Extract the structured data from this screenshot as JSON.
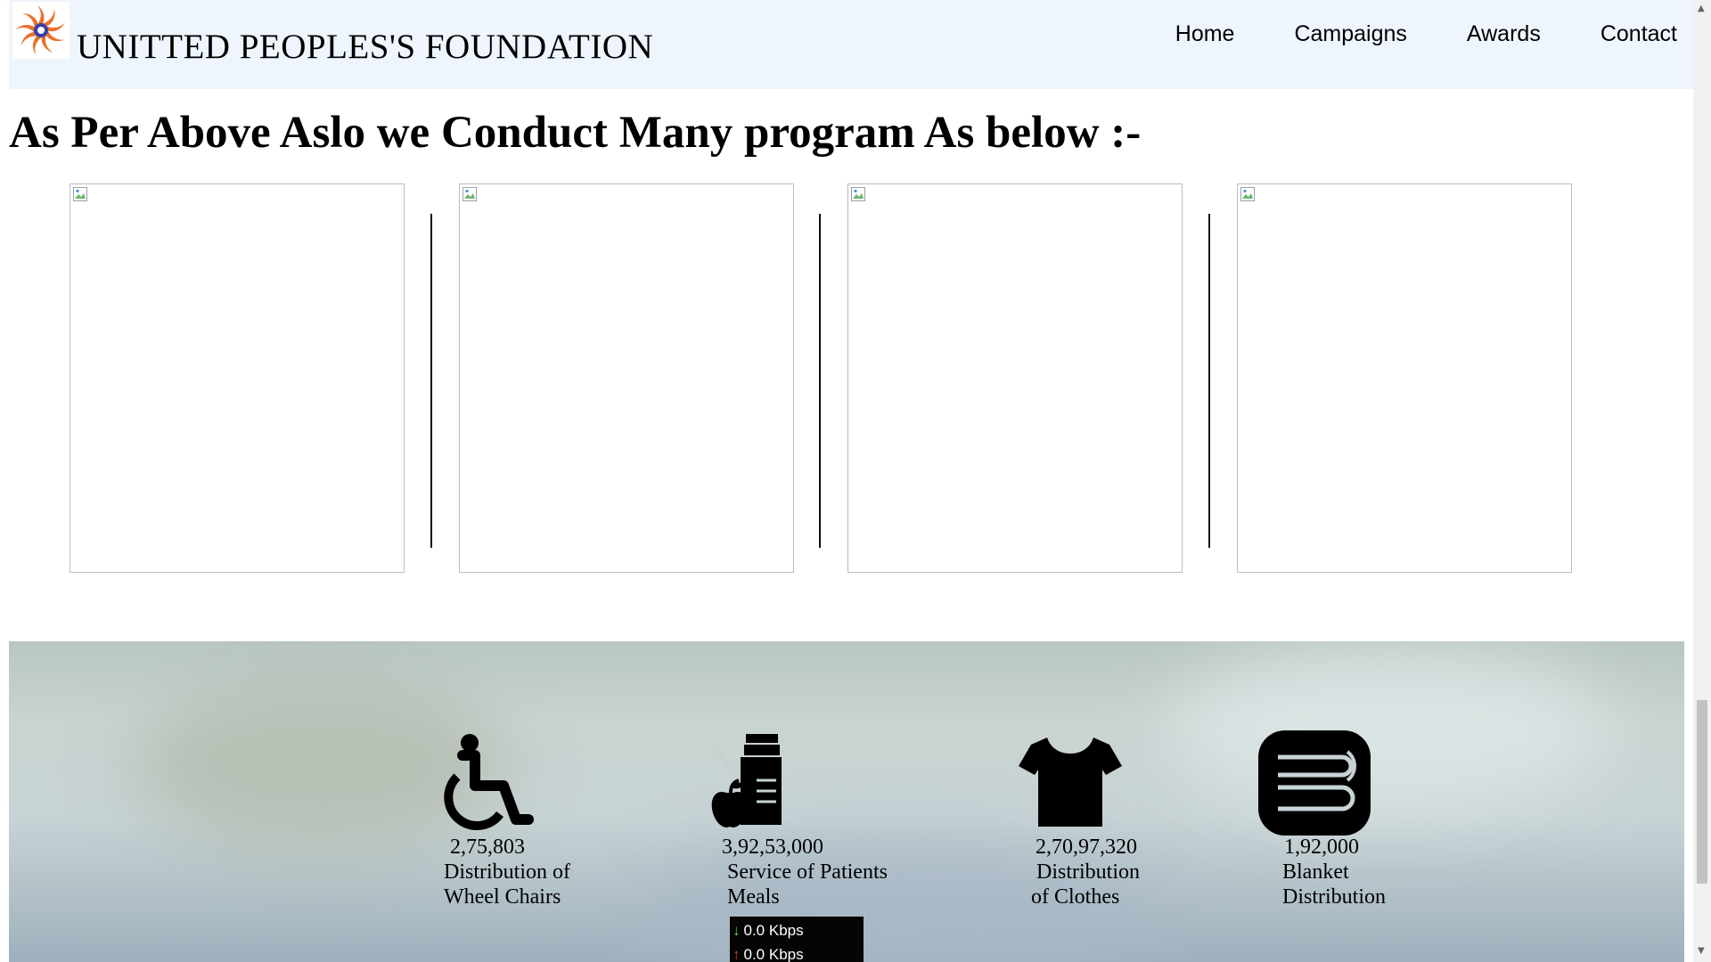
{
  "header": {
    "site_title": "UNITTED PEOPLES'S FOUNDATION",
    "nav": [
      "Home",
      "Campaigns",
      "Awards",
      "Contact"
    ]
  },
  "main": {
    "heading": "As Per Above Aslo we Conduct Many program As below :-"
  },
  "stats": [
    {
      "icon": "wheelchair-icon",
      "number": "2,75,803",
      "label": "Distribution of\nWheel Chairs"
    },
    {
      "icon": "meal-icon",
      "number": "3,92,53,000",
      "label": " Service of Patients\n Meals"
    },
    {
      "icon": "tshirt-icon",
      "number": "2,70,97,320",
      "label": " Distribution\nof Clothes"
    },
    {
      "icon": "blanket-icon",
      "number": "1,92,000",
      "label": " Blanket\n Distribution"
    }
  ],
  "netspeed": {
    "down": "0.0 Kbps",
    "up": "0.0 Kbps"
  },
  "colors": {
    "header_bg": "#eef5fd",
    "logo_orange": "#e8722c",
    "accent": "#e8c449"
  }
}
